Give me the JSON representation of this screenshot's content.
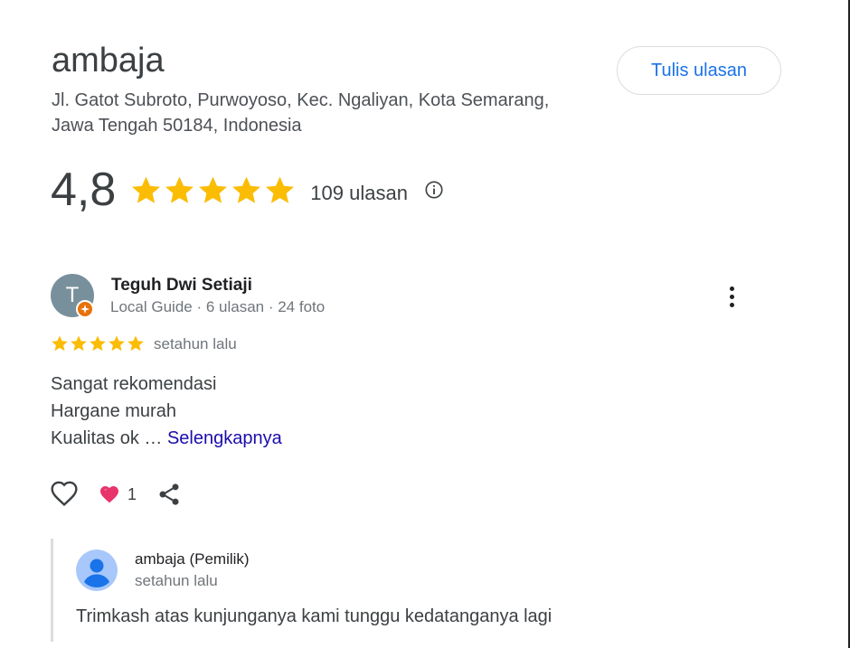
{
  "place": {
    "name": "ambaja",
    "address": "Jl. Gatot Subroto, Purwoyoso, Kec. Ngaliyan, Kota Semarang, Jawa Tengah 50184, Indonesia"
  },
  "write_review_label": "Tulis ulasan",
  "rating": {
    "score": "4,8",
    "stars": 5,
    "count_label": "109 ulasan",
    "info_icon": "info-icon"
  },
  "review": {
    "avatar_letter": "T",
    "reviewer_name": "Teguh Dwi Setiaji",
    "reviewer_meta": "Local Guide · 6 ulasan · 24 foto",
    "stars": 5,
    "time": "setahun lalu",
    "lines": [
      "Sangat rekomendasi",
      "Hargane murah",
      "Kualitas ok …"
    ],
    "more_label": "Selengkapnya",
    "reaction_count": "1"
  },
  "owner_reply": {
    "name": "ambaja (Pemilik)",
    "time": "setahun lalu",
    "text": "Trimkash atas kunjunganya kami tunggu kedatanganya lagi"
  },
  "colors": {
    "star": "#fbbc04",
    "link": "#1a0dab",
    "button_text": "#1a73e8",
    "badge": "#e8710a",
    "avatar_bg": "#78909c"
  }
}
